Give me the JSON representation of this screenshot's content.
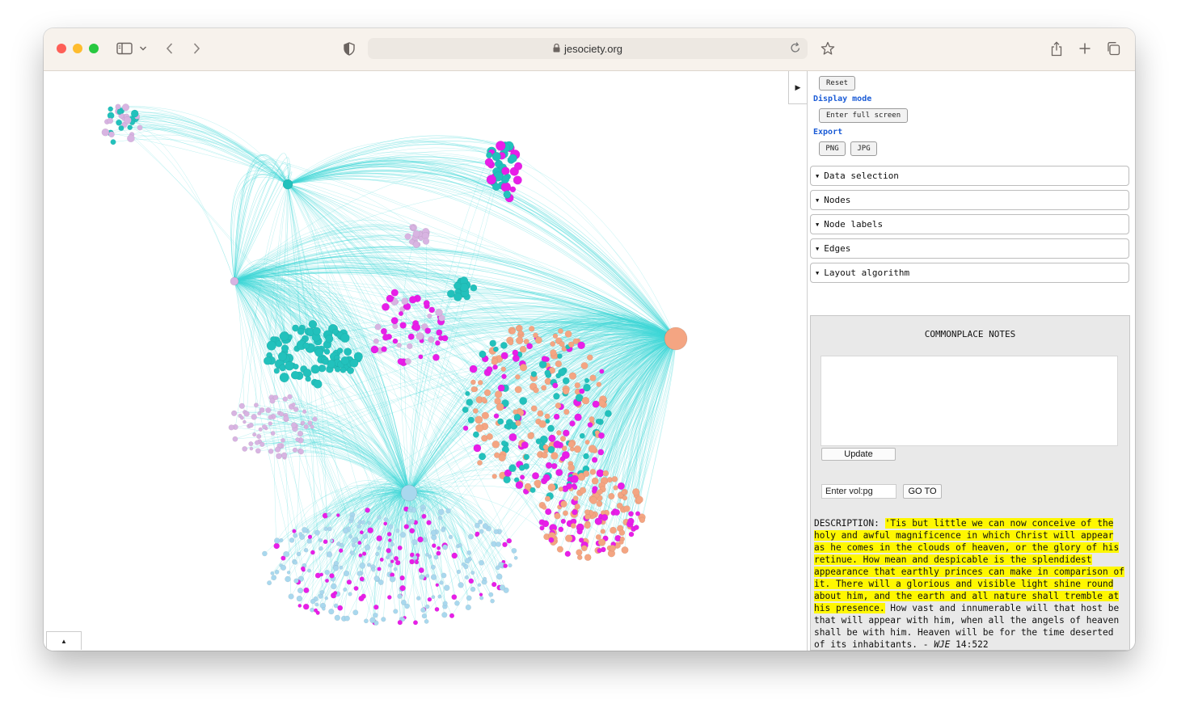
{
  "browser": {
    "url": "jesociety.org"
  },
  "graph": {
    "colors": {
      "edge": "#3fd6d6",
      "teal": "#22c1bc",
      "magenta": "#e81ee8",
      "lavender": "#d8b4e2",
      "salmon": "#f4a582",
      "lightblue": "#a9d8ee"
    },
    "toggle_panel_icon": "▶",
    "toggle_bottom_icon": "▲"
  },
  "panel": {
    "reset_label": "Reset",
    "display_mode_label": "Display mode",
    "fullscreen_label": "Enter full screen",
    "export_label": "Export",
    "png_label": "PNG",
    "jpg_label": "JPG",
    "sections": [
      {
        "label": "Data selection"
      },
      {
        "label": "Nodes"
      },
      {
        "label": "Node labels"
      },
      {
        "label": "Edges"
      },
      {
        "label": "Layout algorithm"
      }
    ],
    "notes": {
      "title": "COMMONPLACE NOTES",
      "update_label": "Update",
      "volpg_value": "Enter vol:pg",
      "goto_label": "GO TO",
      "desc_prefix": "DESCRIPTION: ",
      "desc_highlight": "'Tis but little we can now conceive of the holy and awful magnificence in which Christ will appear as he comes in the clouds of heaven, or the glory of his retinue. How mean and despicable is the splendidest appearance that earthly princes can make in comparison of it. There will a glorious and visible light shine round about him, and the earth and all nature shall tremble at his presence.",
      "desc_plain": " How vast and innumerable will that host be that will appear with him, when all the angels of heaven shall be with him. Heaven will be for the time deserted of its inhabitants. - ",
      "desc_citation_italic": "WJE",
      "desc_citation_ref": " 14:522",
      "separator": "----------"
    }
  }
}
